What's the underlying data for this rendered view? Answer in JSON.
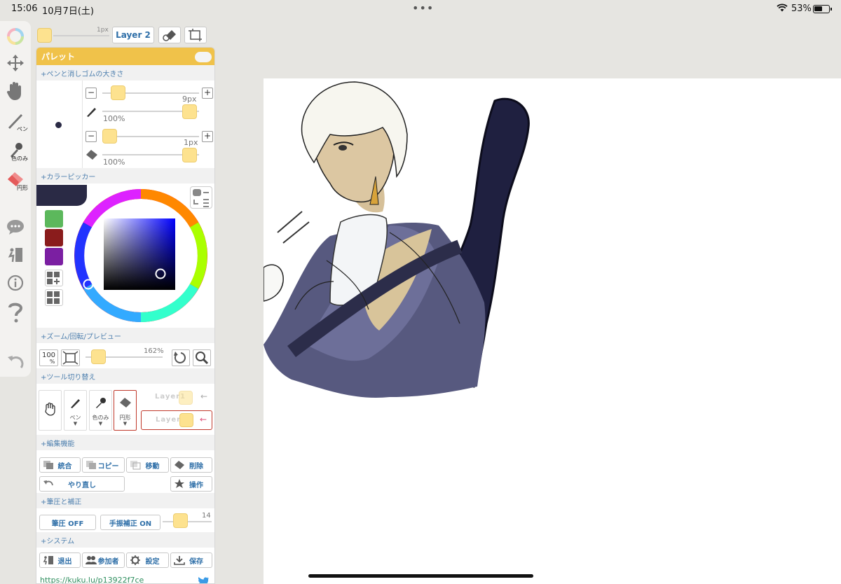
{
  "status": {
    "time": "15:06",
    "date": "10月7日(土)",
    "battery_pct": "53%",
    "battery_level": 0.53
  },
  "topbar": {
    "brush_size": "1px",
    "layer_name": "Layer 2"
  },
  "rail": {
    "pen_label": "ペン",
    "dropper_label": "色のみ",
    "eraser_label": "円形"
  },
  "panel": {
    "title": "パレット",
    "sections": {
      "pen_eraser": "+ペンと消しゴムの大きさ",
      "color_picker": "+カラーピッカー",
      "zoom": "+ズーム/回転/プレビュー",
      "tool_switch": "+ツール切り替え",
      "edit": "+編集機能",
      "pressure": "+筆圧と補正",
      "system": "+システム"
    },
    "pen": {
      "size": "9px",
      "opacity": "100%"
    },
    "eraser": {
      "size": "1px",
      "opacity": "100%"
    },
    "minus": "−",
    "plus": "+",
    "colors": {
      "current": "#2a2a45",
      "swatches": [
        "#5cb85c",
        "#8a1c1c",
        "#7b1fa2"
      ]
    },
    "zoom": {
      "reset_label": "100",
      "reset_unit": "%",
      "value": "162%"
    },
    "tools": {
      "pen": "ペン",
      "dropper": "色のみ",
      "eraser": "円形",
      "caret": "▼"
    },
    "layers": [
      {
        "name": "Layer1",
        "arrow": "←"
      },
      {
        "name": "Layer2",
        "arrow": "←"
      }
    ],
    "edit": {
      "merge": "統合",
      "copy": "コピー",
      "move": "移動",
      "delete": "削除",
      "redo": "やり直し",
      "operate": "操作"
    },
    "pressure": {
      "pressure_btn": "筆圧 OFF",
      "stabilizer_btn": "手振補正 ON",
      "stabilizer_value": "14"
    },
    "system": {
      "exit": "退出",
      "participants": "参加者",
      "settings": "設定",
      "save": "保存"
    },
    "url": "https://kuku.lu/p13922f7ce"
  }
}
